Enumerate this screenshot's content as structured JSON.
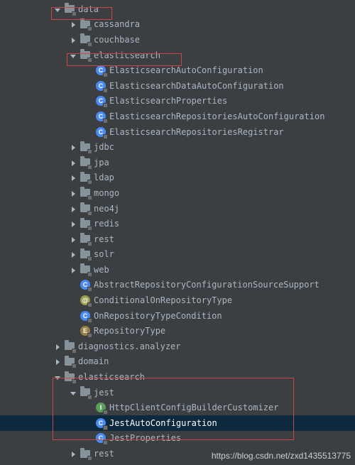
{
  "tree": [
    {
      "indent": 3,
      "arrow": "expanded",
      "icon": "package",
      "label": "data"
    },
    {
      "indent": 4,
      "arrow": "collapsed",
      "icon": "package",
      "label": "cassandra"
    },
    {
      "indent": 4,
      "arrow": "collapsed",
      "icon": "package",
      "label": "couchbase"
    },
    {
      "indent": 4,
      "arrow": "expanded",
      "icon": "package",
      "label": "elasticsearch"
    },
    {
      "indent": 5,
      "arrow": "none",
      "icon": "class",
      "letter": "C",
      "ccls": "c-class",
      "label": "ElasticsearchAutoConfiguration"
    },
    {
      "indent": 5,
      "arrow": "none",
      "icon": "class",
      "letter": "C",
      "ccls": "c-class",
      "label": "ElasticsearchDataAutoConfiguration"
    },
    {
      "indent": 5,
      "arrow": "none",
      "icon": "class",
      "letter": "C",
      "ccls": "c-class",
      "label": "ElasticsearchProperties"
    },
    {
      "indent": 5,
      "arrow": "none",
      "icon": "class",
      "letter": "C",
      "ccls": "c-class",
      "label": "ElasticsearchRepositoriesAutoConfiguration"
    },
    {
      "indent": 5,
      "arrow": "none",
      "icon": "class",
      "letter": "C",
      "ccls": "c-class",
      "label": "ElasticsearchRepositoriesRegistrar"
    },
    {
      "indent": 4,
      "arrow": "collapsed",
      "icon": "package",
      "label": "jdbc"
    },
    {
      "indent": 4,
      "arrow": "collapsed",
      "icon": "package",
      "label": "jpa"
    },
    {
      "indent": 4,
      "arrow": "collapsed",
      "icon": "package",
      "label": "ldap"
    },
    {
      "indent": 4,
      "arrow": "collapsed",
      "icon": "package",
      "label": "mongo"
    },
    {
      "indent": 4,
      "arrow": "collapsed",
      "icon": "package",
      "label": "neo4j"
    },
    {
      "indent": 4,
      "arrow": "collapsed",
      "icon": "package",
      "label": "redis"
    },
    {
      "indent": 4,
      "arrow": "collapsed",
      "icon": "package",
      "label": "rest"
    },
    {
      "indent": 4,
      "arrow": "collapsed",
      "icon": "package",
      "label": "solr"
    },
    {
      "indent": 4,
      "arrow": "collapsed",
      "icon": "package",
      "label": "web"
    },
    {
      "indent": 4,
      "arrow": "none",
      "icon": "class",
      "letter": "C",
      "ccls": "c-class",
      "label": "AbstractRepositoryConfigurationSourceSupport"
    },
    {
      "indent": 4,
      "arrow": "none",
      "icon": "class",
      "letter": "@",
      "ccls": "c-annotation",
      "label": "ConditionalOnRepositoryType"
    },
    {
      "indent": 4,
      "arrow": "none",
      "icon": "class",
      "letter": "C",
      "ccls": "c-class",
      "label": "OnRepositoryTypeCondition"
    },
    {
      "indent": 4,
      "arrow": "none",
      "icon": "class",
      "letter": "E",
      "ccls": "c-enum",
      "label": "RepositoryType"
    },
    {
      "indent": 3,
      "arrow": "collapsed",
      "icon": "package",
      "label": "diagnostics.analyzer"
    },
    {
      "indent": 3,
      "arrow": "collapsed",
      "icon": "package",
      "label": "domain"
    },
    {
      "indent": 3,
      "arrow": "expanded",
      "icon": "package",
      "label": "elasticsearch"
    },
    {
      "indent": 4,
      "arrow": "expanded",
      "icon": "package",
      "label": "jest"
    },
    {
      "indent": 5,
      "arrow": "none",
      "icon": "class",
      "letter": "I",
      "ccls": "c-interface",
      "label": "HttpClientConfigBuilderCustomizer"
    },
    {
      "indent": 5,
      "arrow": "none",
      "icon": "class",
      "letter": "C",
      "ccls": "c-class",
      "label": "JestAutoConfiguration",
      "selected": true
    },
    {
      "indent": 5,
      "arrow": "none",
      "icon": "class",
      "letter": "C",
      "ccls": "c-class",
      "label": "JestProperties"
    },
    {
      "indent": 4,
      "arrow": "collapsed",
      "icon": "package",
      "label": "rest"
    }
  ],
  "watermark": "https://blog.csdn.net/zxd1435513775"
}
